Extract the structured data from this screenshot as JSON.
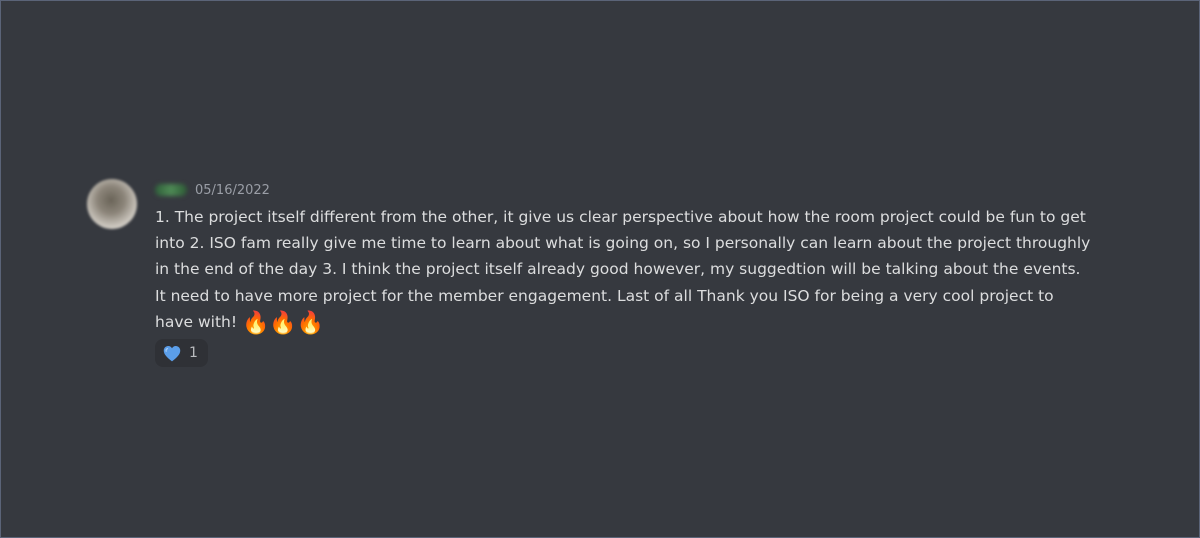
{
  "message": {
    "username": "",
    "timestamp": "05/16/2022",
    "text": "1. The project itself different from the other, it give us clear perspective about how the room project could be fun to get into 2. ISO fam really give me time to learn about what is going on, so I personally can learn about the project throughly in the end of the day 3. I think the project itself already good however, my suggedtion will be talking about the events. It need to have more project for the member engagement. Last of all Thank you ISO for being a very cool project to have with!",
    "emojis": [
      "🔥",
      "🔥",
      "🔥"
    ],
    "reaction": {
      "icon": "blue-heart-icon",
      "count": "1",
      "color": "#5b9ee9"
    }
  }
}
